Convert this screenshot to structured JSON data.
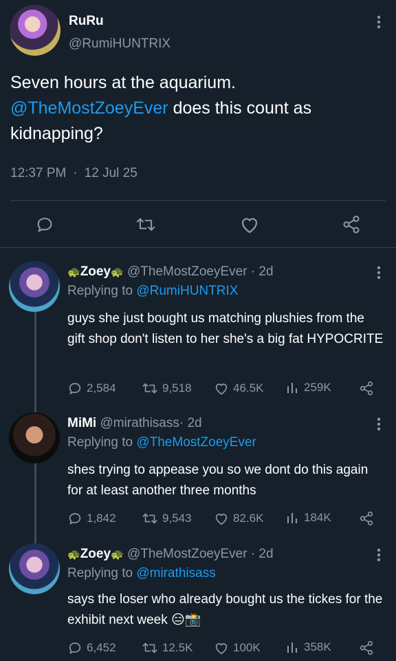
{
  "tweet": {
    "author_name": "RuRu",
    "author_handle": "@RumiHUNTRIX",
    "text_mention": "@TheMostZoeyEver",
    "text_part1": "Seven hours at the aquarium.",
    "text_part2": " does this count as kidnapping?",
    "time": "12:37 PM",
    "separator": "·",
    "date": "12 Jul 25",
    "actions": [
      "reply-icon",
      "retweet-icon",
      "like-icon",
      "share-icon"
    ]
  },
  "replies": [
    {
      "name": "Zoey",
      "name_emoji": "🐢",
      "handle": "@TheMostZoeyEver",
      "age": "· 2d",
      "replying_label": "Replying to",
      "replying_to": "@RumiHUNTRIX",
      "text": "guys she just bought us matching plushies from the gift shop don't listen to her she's a big fat HYPOCRITE",
      "replies": "2,584",
      "retweets": "9,518",
      "likes": "46.5K",
      "views": "259K"
    },
    {
      "name": "MiMi",
      "handle": "@mirathisass",
      "age": "· 2d",
      "replying_label": "Replying to",
      "replying_to": "@TheMostZoeyEver",
      "text": "shes trying to appease you so we dont do this again for at least another three months",
      "replies": "1,842",
      "retweets": "9,543",
      "likes": "82.6K",
      "views": "184K"
    },
    {
      "name": "Zoey",
      "name_emoji": "🐢",
      "handle": "@TheMostZoeyEver",
      "age": "· 2d",
      "replying_label": "Replying to",
      "replying_to": "@mirathisass",
      "text": "says the loser who already bought us the tickes for the exhibit next week",
      "text_emoji": "😑📸",
      "replies": "6,452",
      "retweets": "12.5K",
      "likes": "100K",
      "views": "358K"
    }
  ],
  "colors": {
    "background": "#15202b",
    "link": "#1d9bf0",
    "muted": "#8b98a5",
    "divider": "#38444d"
  }
}
